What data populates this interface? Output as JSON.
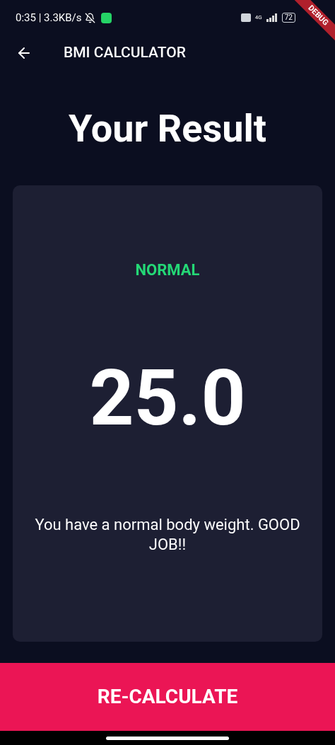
{
  "status_bar": {
    "time_speed": "0:35 | 3.3KB/s",
    "network": "4G",
    "battery": "72"
  },
  "debug_banner": "DEBUG",
  "app_bar": {
    "title": "BMI CALCULATOR"
  },
  "heading": "Your Result",
  "result": {
    "category": "NORMAL",
    "color": "#24d876",
    "bmi": "25.0",
    "message": "You have a normal body weight. GOOD JOB!!"
  },
  "button": "RE-CALCULATE"
}
